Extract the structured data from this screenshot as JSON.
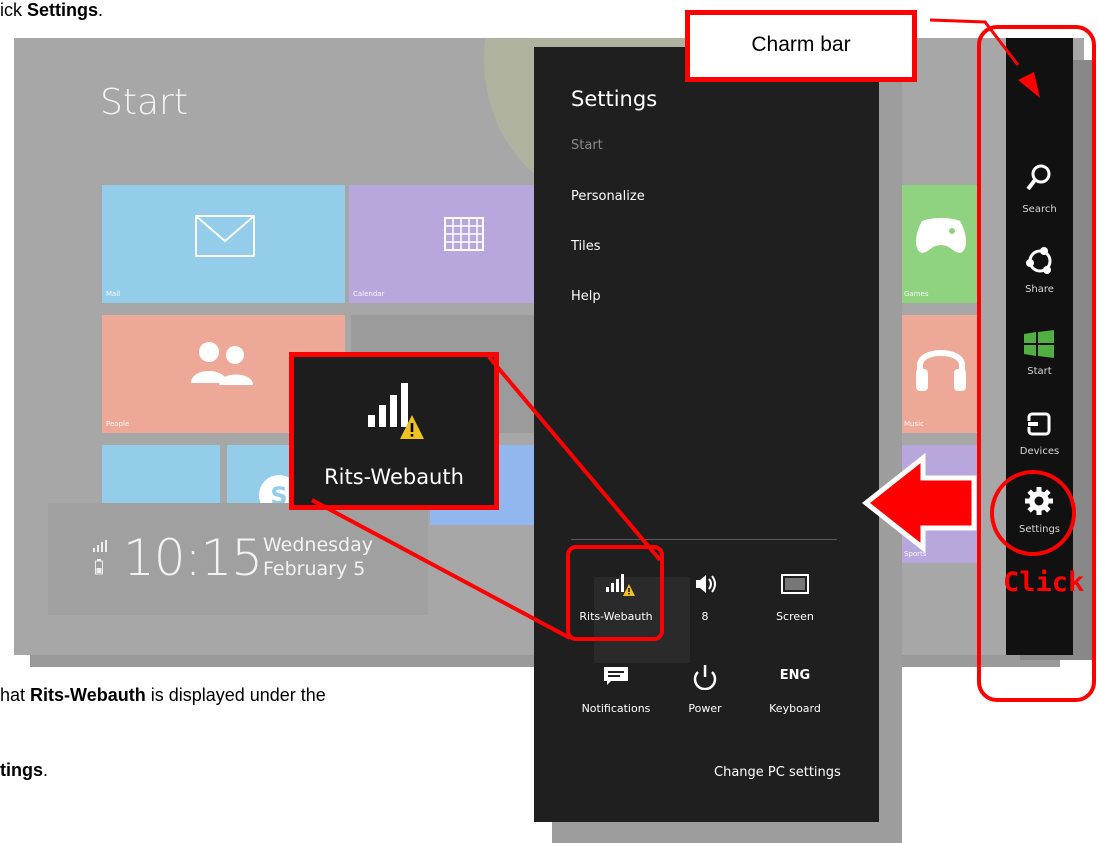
{
  "doc": {
    "line1_prefix": "ick ",
    "line1_bold": "Settings",
    "line1_suffix": ".",
    "line2_prefix": "hat ",
    "line2_bold": "Rits-Webauth",
    "line2_suffix": " is displayed under the",
    "line3_bold": "tings",
    "line3_suffix": "."
  },
  "start": {
    "title": "Start",
    "tiles": [
      {
        "label": "Mail",
        "color": "#94cdea"
      },
      {
        "label": "Calendar",
        "color": "#b7a7dd"
      },
      {
        "label": "People",
        "color": "#eea897"
      },
      {
        "label": "Games",
        "color": "#8fd27f"
      },
      {
        "label": "Music",
        "color": "#eea897"
      },
      {
        "label": "Sports",
        "color": "#b7a7dd"
      }
    ],
    "clock": {
      "time": "10:15",
      "day": "Wednesday",
      "date": "February 5"
    }
  },
  "settings": {
    "title": "Settings",
    "subtitle": "Start",
    "links": [
      "Personalize",
      "Tiles",
      "Help"
    ],
    "quick": [
      {
        "label": "Rits-Webauth",
        "icon": "wifi-warning-icon"
      },
      {
        "label": "8",
        "icon": "volume-icon"
      },
      {
        "label": "Screen",
        "icon": "screen-icon"
      },
      {
        "label": "Notifications",
        "icon": "notifications-icon"
      },
      {
        "label": "Power",
        "icon": "power-icon"
      },
      {
        "label": "Keyboard",
        "icon": "keyboard-icon",
        "badge": "ENG"
      }
    ],
    "change_pc": "Change PC settings"
  },
  "charms": [
    {
      "label": "Search",
      "icon": "search-icon"
    },
    {
      "label": "Share",
      "icon": "share-icon"
    },
    {
      "label": "Start",
      "icon": "windows-logo-icon"
    },
    {
      "label": "Devices",
      "icon": "devices-icon"
    },
    {
      "label": "Settings",
      "icon": "gear-icon"
    }
  ],
  "annotations": {
    "charm_bar_label": "Charm bar",
    "click_label": "Click",
    "zoom_label": "Rits-Webauth",
    "accent": "#ff0000"
  }
}
